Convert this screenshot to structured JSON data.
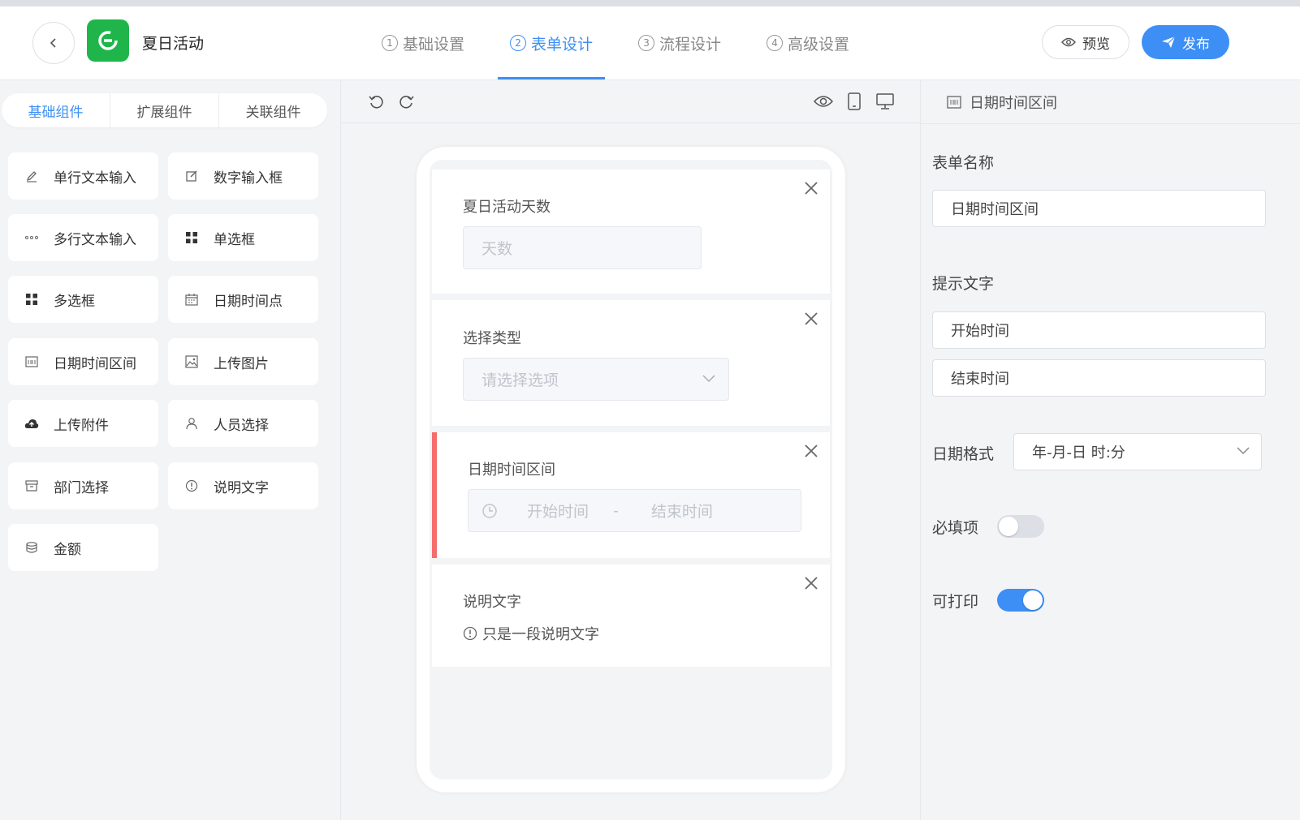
{
  "app": {
    "title": "夏日活动"
  },
  "steps": [
    {
      "num": "1",
      "label": "基础设置"
    },
    {
      "num": "2",
      "label": "表单设计",
      "active": true
    },
    {
      "num": "3",
      "label": "流程设计"
    },
    {
      "num": "4",
      "label": "高级设置"
    }
  ],
  "actions": {
    "preview": "预览",
    "publish": "发布"
  },
  "left": {
    "tabs": [
      "基础组件",
      "扩展组件",
      "关联组件"
    ],
    "components": [
      {
        "label": "单行文本输入",
        "icon": "pen-icon"
      },
      {
        "label": "数字输入框",
        "icon": "edit-icon"
      },
      {
        "label": "多行文本输入",
        "icon": "dots-icon"
      },
      {
        "label": "单选框",
        "icon": "grid-icon"
      },
      {
        "label": "多选框",
        "icon": "grid-icon"
      },
      {
        "label": "日期时间点",
        "icon": "calendar-icon"
      },
      {
        "label": "日期时间区间",
        "icon": "date-range-icon"
      },
      {
        "label": "上传图片",
        "icon": "image-icon"
      },
      {
        "label": "上传附件",
        "icon": "cloud-upload-icon"
      },
      {
        "label": "人员选择",
        "icon": "user-icon"
      },
      {
        "label": "部门选择",
        "icon": "archive-icon"
      },
      {
        "label": "说明文字",
        "icon": "info-icon"
      },
      {
        "label": "金额",
        "icon": "coins-icon"
      }
    ]
  },
  "form": {
    "fields": [
      {
        "label": "夏日活动天数",
        "placeholder": "天数"
      },
      {
        "label": "选择类型",
        "placeholder": "请选择选项"
      },
      {
        "label": "日期时间区间",
        "start": "开始时间",
        "sep": "-",
        "end": "结束时间"
      },
      {
        "label": "说明文字",
        "text": "只是一段说明文字"
      }
    ]
  },
  "right": {
    "header": "日期时间区间",
    "form_name_label": "表单名称",
    "form_name_value": "日期时间区间",
    "hint_label": "提示文字",
    "hint_start": "开始时间",
    "hint_end": "结束时间",
    "date_format_label": "日期格式",
    "date_format_value": "年-月-日 时:分",
    "required_label": "必填项",
    "required": false,
    "printable_label": "可打印",
    "printable": true
  },
  "colors": {
    "accent": "#3d8ff5",
    "logo": "#1fb54a",
    "selected_bar": "#f56c6c"
  }
}
